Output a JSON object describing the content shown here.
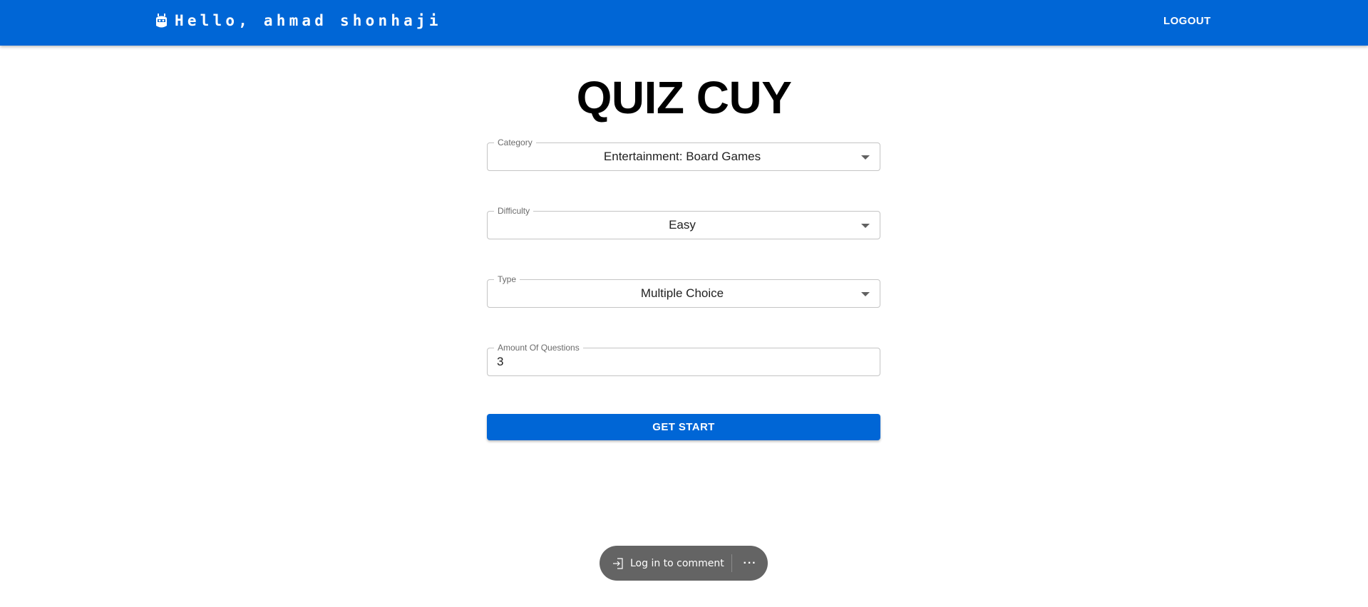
{
  "header": {
    "greeting": "Hello, ahmad shonhaji",
    "logout_label": "LOGOUT",
    "brand_color": "#0066d6",
    "icon": "robot-icon"
  },
  "main": {
    "title": "QUIZ CUY",
    "category": {
      "label": "Category",
      "value": "Entertainment: Board Games"
    },
    "difficulty": {
      "label": "Difficulty",
      "value": "Easy"
    },
    "type": {
      "label": "Type",
      "value": "Multiple Choice"
    },
    "amount": {
      "label": "Amount Of Questions",
      "value": "3"
    },
    "start_label": "GET START"
  },
  "comment_bar": {
    "login_label": "Log in to comment",
    "more_label": "···",
    "icons": [
      "login-arrow-icon",
      "more-icon"
    ]
  }
}
